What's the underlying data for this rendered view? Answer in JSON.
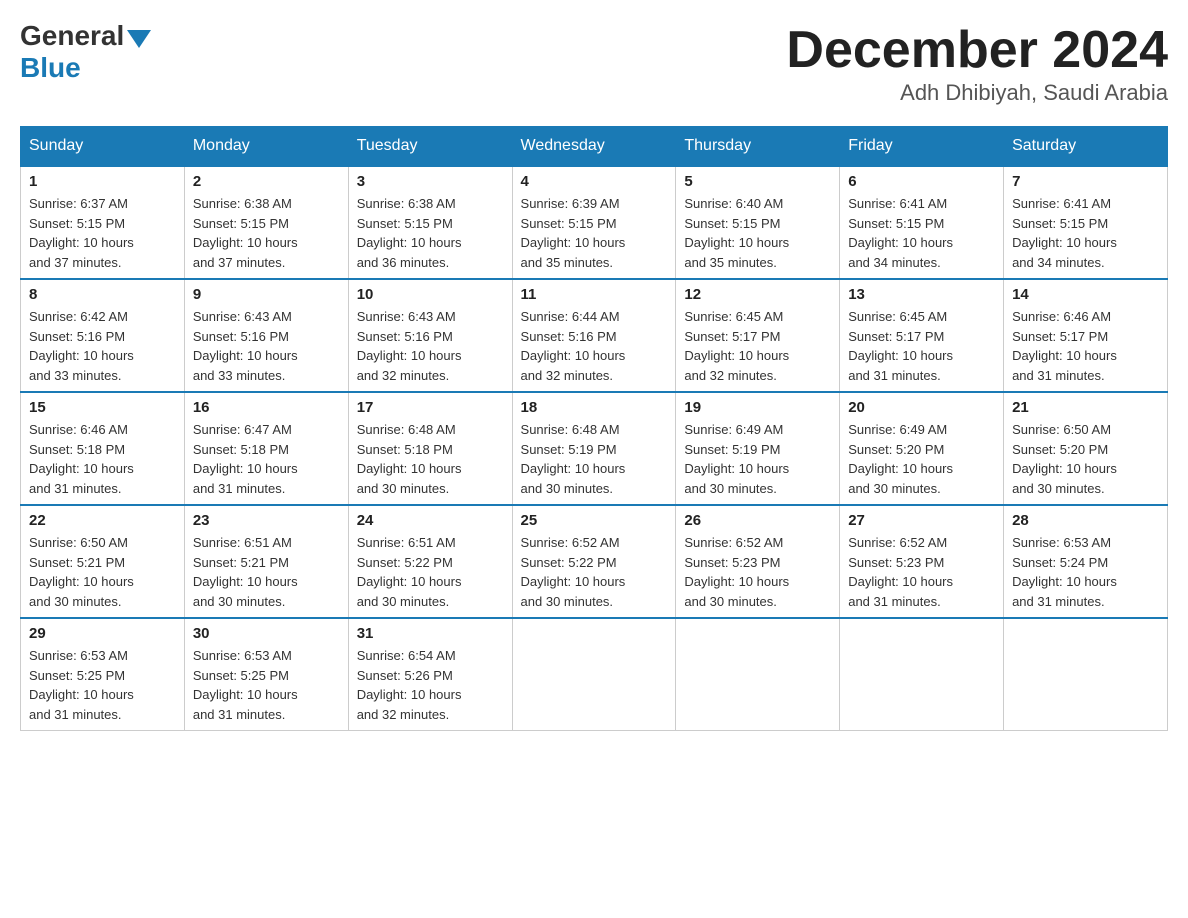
{
  "header": {
    "logo_general": "General",
    "logo_blue": "Blue",
    "month_year": "December 2024",
    "location": "Adh Dhibiyah, Saudi Arabia"
  },
  "days_of_week": [
    "Sunday",
    "Monday",
    "Tuesday",
    "Wednesday",
    "Thursday",
    "Friday",
    "Saturday"
  ],
  "weeks": [
    [
      {
        "day": "1",
        "sunrise": "6:37 AM",
        "sunset": "5:15 PM",
        "daylight": "10 hours and 37 minutes."
      },
      {
        "day": "2",
        "sunrise": "6:38 AM",
        "sunset": "5:15 PM",
        "daylight": "10 hours and 37 minutes."
      },
      {
        "day": "3",
        "sunrise": "6:38 AM",
        "sunset": "5:15 PM",
        "daylight": "10 hours and 36 minutes."
      },
      {
        "day": "4",
        "sunrise": "6:39 AM",
        "sunset": "5:15 PM",
        "daylight": "10 hours and 35 minutes."
      },
      {
        "day": "5",
        "sunrise": "6:40 AM",
        "sunset": "5:15 PM",
        "daylight": "10 hours and 35 minutes."
      },
      {
        "day": "6",
        "sunrise": "6:41 AM",
        "sunset": "5:15 PM",
        "daylight": "10 hours and 34 minutes."
      },
      {
        "day": "7",
        "sunrise": "6:41 AM",
        "sunset": "5:15 PM",
        "daylight": "10 hours and 34 minutes."
      }
    ],
    [
      {
        "day": "8",
        "sunrise": "6:42 AM",
        "sunset": "5:16 PM",
        "daylight": "10 hours and 33 minutes."
      },
      {
        "day": "9",
        "sunrise": "6:43 AM",
        "sunset": "5:16 PM",
        "daylight": "10 hours and 33 minutes."
      },
      {
        "day": "10",
        "sunrise": "6:43 AM",
        "sunset": "5:16 PM",
        "daylight": "10 hours and 32 minutes."
      },
      {
        "day": "11",
        "sunrise": "6:44 AM",
        "sunset": "5:16 PM",
        "daylight": "10 hours and 32 minutes."
      },
      {
        "day": "12",
        "sunrise": "6:45 AM",
        "sunset": "5:17 PM",
        "daylight": "10 hours and 32 minutes."
      },
      {
        "day": "13",
        "sunrise": "6:45 AM",
        "sunset": "5:17 PM",
        "daylight": "10 hours and 31 minutes."
      },
      {
        "day": "14",
        "sunrise": "6:46 AM",
        "sunset": "5:17 PM",
        "daylight": "10 hours and 31 minutes."
      }
    ],
    [
      {
        "day": "15",
        "sunrise": "6:46 AM",
        "sunset": "5:18 PM",
        "daylight": "10 hours and 31 minutes."
      },
      {
        "day": "16",
        "sunrise": "6:47 AM",
        "sunset": "5:18 PM",
        "daylight": "10 hours and 31 minutes."
      },
      {
        "day": "17",
        "sunrise": "6:48 AM",
        "sunset": "5:18 PM",
        "daylight": "10 hours and 30 minutes."
      },
      {
        "day": "18",
        "sunrise": "6:48 AM",
        "sunset": "5:19 PM",
        "daylight": "10 hours and 30 minutes."
      },
      {
        "day": "19",
        "sunrise": "6:49 AM",
        "sunset": "5:19 PM",
        "daylight": "10 hours and 30 minutes."
      },
      {
        "day": "20",
        "sunrise": "6:49 AM",
        "sunset": "5:20 PM",
        "daylight": "10 hours and 30 minutes."
      },
      {
        "day": "21",
        "sunrise": "6:50 AM",
        "sunset": "5:20 PM",
        "daylight": "10 hours and 30 minutes."
      }
    ],
    [
      {
        "day": "22",
        "sunrise": "6:50 AM",
        "sunset": "5:21 PM",
        "daylight": "10 hours and 30 minutes."
      },
      {
        "day": "23",
        "sunrise": "6:51 AM",
        "sunset": "5:21 PM",
        "daylight": "10 hours and 30 minutes."
      },
      {
        "day": "24",
        "sunrise": "6:51 AM",
        "sunset": "5:22 PM",
        "daylight": "10 hours and 30 minutes."
      },
      {
        "day": "25",
        "sunrise": "6:52 AM",
        "sunset": "5:22 PM",
        "daylight": "10 hours and 30 minutes."
      },
      {
        "day": "26",
        "sunrise": "6:52 AM",
        "sunset": "5:23 PM",
        "daylight": "10 hours and 30 minutes."
      },
      {
        "day": "27",
        "sunrise": "6:52 AM",
        "sunset": "5:23 PM",
        "daylight": "10 hours and 31 minutes."
      },
      {
        "day": "28",
        "sunrise": "6:53 AM",
        "sunset": "5:24 PM",
        "daylight": "10 hours and 31 minutes."
      }
    ],
    [
      {
        "day": "29",
        "sunrise": "6:53 AM",
        "sunset": "5:25 PM",
        "daylight": "10 hours and 31 minutes."
      },
      {
        "day": "30",
        "sunrise": "6:53 AM",
        "sunset": "5:25 PM",
        "daylight": "10 hours and 31 minutes."
      },
      {
        "day": "31",
        "sunrise": "6:54 AM",
        "sunset": "5:26 PM",
        "daylight": "10 hours and 32 minutes."
      },
      null,
      null,
      null,
      null
    ]
  ],
  "labels": {
    "sunrise": "Sunrise:",
    "sunset": "Sunset:",
    "daylight": "Daylight:"
  }
}
